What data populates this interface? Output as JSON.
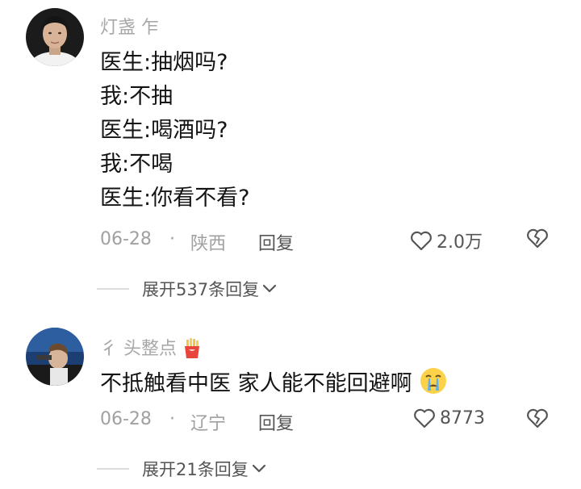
{
  "comments": [
    {
      "username": "灯盏    乍",
      "body_lines": [
        "医生:抽烟吗?",
        "我:不抽",
        "医生:喝酒吗?",
        "我:不喝",
        "医生:你看不看?"
      ],
      "date": "06-28",
      "separator": "·",
      "location": "陕西",
      "reply_label": "回复",
      "like_count": "2.0万",
      "expand_label": "展开537条回复"
    },
    {
      "username": "彳        头整点",
      "body_text": "不抵触看中医 家人能不能回避啊",
      "date": "06-28",
      "separator": "·",
      "location": "辽宁",
      "reply_label": "回复",
      "like_count": "8773",
      "expand_label": "展开21条回复"
    }
  ],
  "colors": {
    "meta_gray": "#a0a0a0",
    "action_gray": "#555555",
    "text_primary": "#141414"
  },
  "icons": [
    "heart-outline-icon",
    "broken-heart-icon",
    "chevron-down-icon",
    "fries-emoji",
    "crying-face-emoji"
  ]
}
